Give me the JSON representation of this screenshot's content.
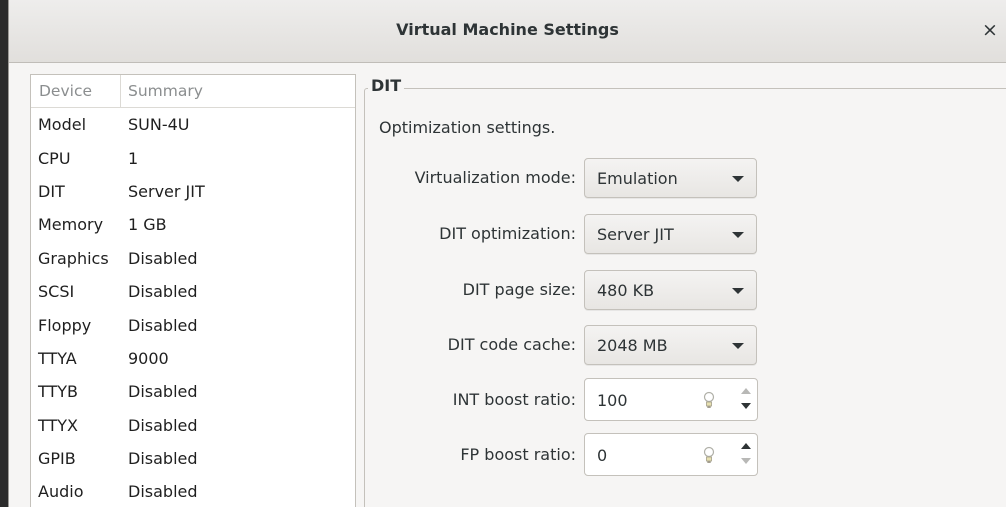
{
  "window": {
    "title": "Virtual Machine Settings",
    "close_glyph": "×"
  },
  "device_list": {
    "headers": [
      "Device",
      "Summary"
    ],
    "rows": [
      {
        "device": "Model",
        "summary": "SUN-4U"
      },
      {
        "device": "CPU",
        "summary": "1"
      },
      {
        "device": "DIT",
        "summary": "Server JIT"
      },
      {
        "device": "Memory",
        "summary": "1 GB"
      },
      {
        "device": "Graphics",
        "summary": "Disabled"
      },
      {
        "device": "SCSI",
        "summary": "Disabled"
      },
      {
        "device": "Floppy",
        "summary": "Disabled"
      },
      {
        "device": "TTYA",
        "summary": "9000"
      },
      {
        "device": "TTYB",
        "summary": "Disabled"
      },
      {
        "device": "TTYX",
        "summary": "Disabled"
      },
      {
        "device": "GPIB",
        "summary": "Disabled"
      },
      {
        "device": "Audio",
        "summary": "Disabled"
      }
    ]
  },
  "dit_panel": {
    "frame_label": "DIT",
    "description": "Optimization settings.",
    "virtualization_mode": {
      "label": "Virtualization mode:",
      "value": "Emulation"
    },
    "dit_optimization": {
      "label": "DIT optimization:",
      "value": "Server JIT"
    },
    "dit_page_size": {
      "label": "DIT page size:",
      "value": "480 KB"
    },
    "dit_code_cache": {
      "label": "DIT code cache:",
      "value": "2048 MB"
    },
    "int_boost_ratio": {
      "label": "INT boost ratio:",
      "value": "100"
    },
    "fp_boost_ratio": {
      "label": "FP boost ratio:",
      "value": "0"
    }
  }
}
